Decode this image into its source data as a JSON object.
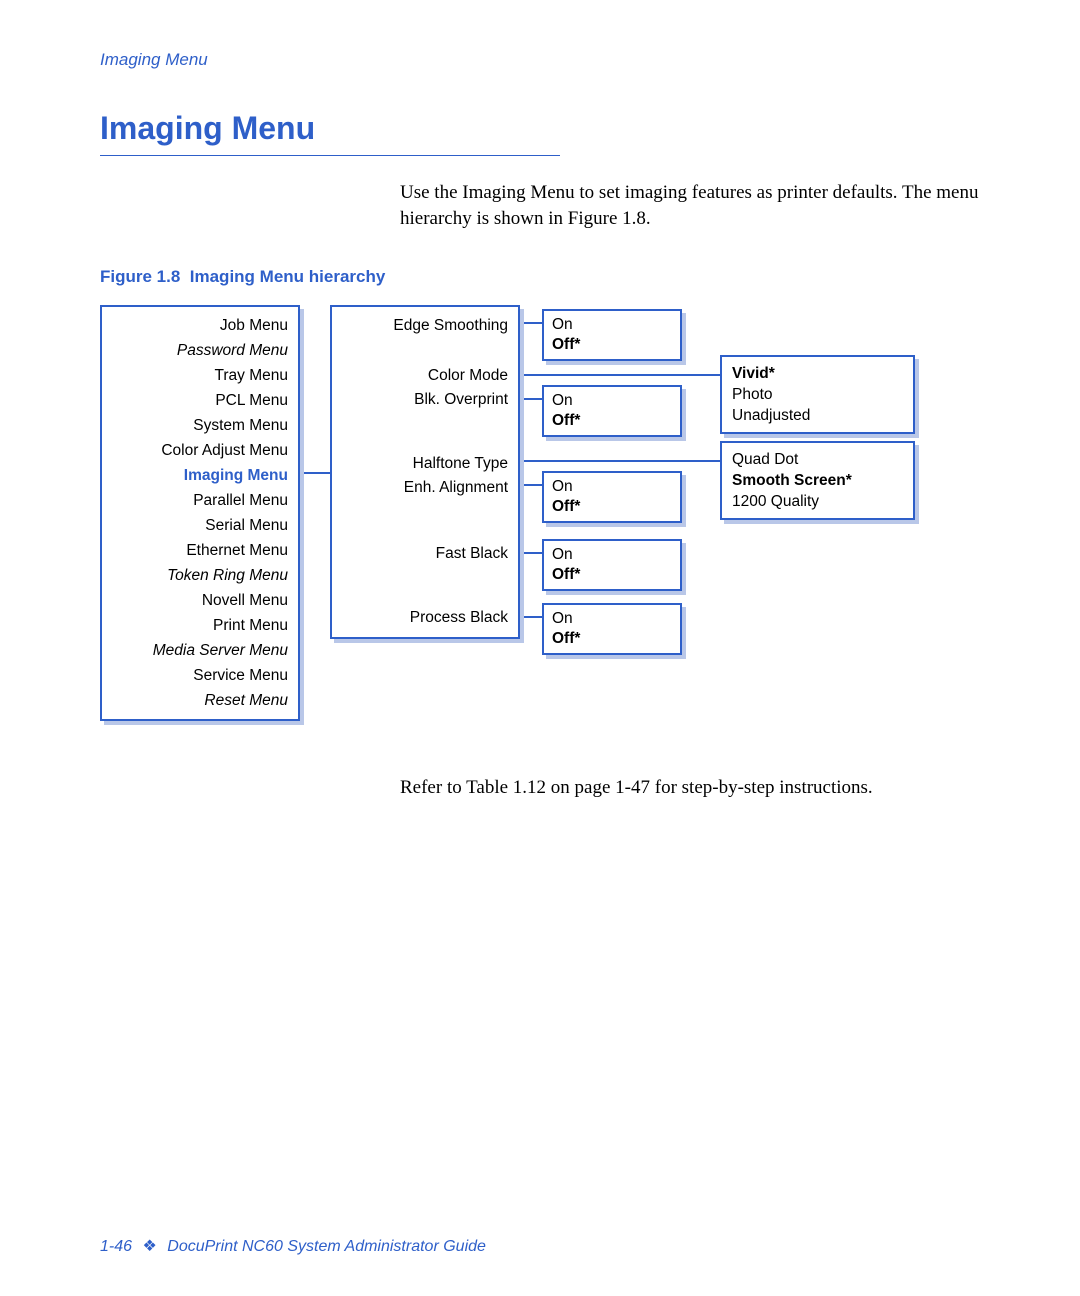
{
  "header": {
    "running": "Imaging Menu"
  },
  "title": "Imaging Menu",
  "intro": "Use the Imaging Menu to set imaging features as printer defaults. The menu hierarchy is shown in Figure 1.8.",
  "figure_caption_prefix": "Figure 1.8",
  "figure_caption_text": "Imaging Menu hierarchy",
  "menus": {
    "m0": "Job Menu",
    "m1": "Password Menu",
    "m2": "Tray Menu",
    "m3": "PCL Menu",
    "m4": "System Menu",
    "m5": "Color Adjust Menu",
    "m6": "Imaging Menu",
    "m7": "Parallel Menu",
    "m8": "Serial Menu",
    "m9": "Ethernet Menu",
    "m10": "Token Ring Menu",
    "m11": "Novell Menu",
    "m12": "Print Menu",
    "m13": "Media Server Menu",
    "m14": "Service Menu",
    "m15": "Reset Menu"
  },
  "subitems": {
    "s0": "Edge Smoothing",
    "s1": "Color Mode",
    "s2": "Blk. Overprint",
    "s3": "Halftone Type",
    "s4": "Enh. Alignment",
    "s5": "Fast Black",
    "s6": "Process Black"
  },
  "opts": {
    "edge_on": "On",
    "edge_off": "Off*",
    "blk_on": "On",
    "blk_off": "Off*",
    "enh_on": "On",
    "enh_off": "Off*",
    "fast_on": "On",
    "fast_off": "Off*",
    "proc_on": "On",
    "proc_off": "Off*",
    "color_vivid": "Vivid*",
    "color_photo": "Photo",
    "color_unadj": "Unadjusted",
    "half_quad": "Quad Dot",
    "half_smooth": "Smooth Screen*",
    "half_1200": "1200 Quality"
  },
  "outro": "Refer to Table 1.12 on page 1-47 for step-by-step instructions.",
  "footer": {
    "page": "1-46",
    "title": "DocuPrint NC60 System Administrator Guide"
  }
}
